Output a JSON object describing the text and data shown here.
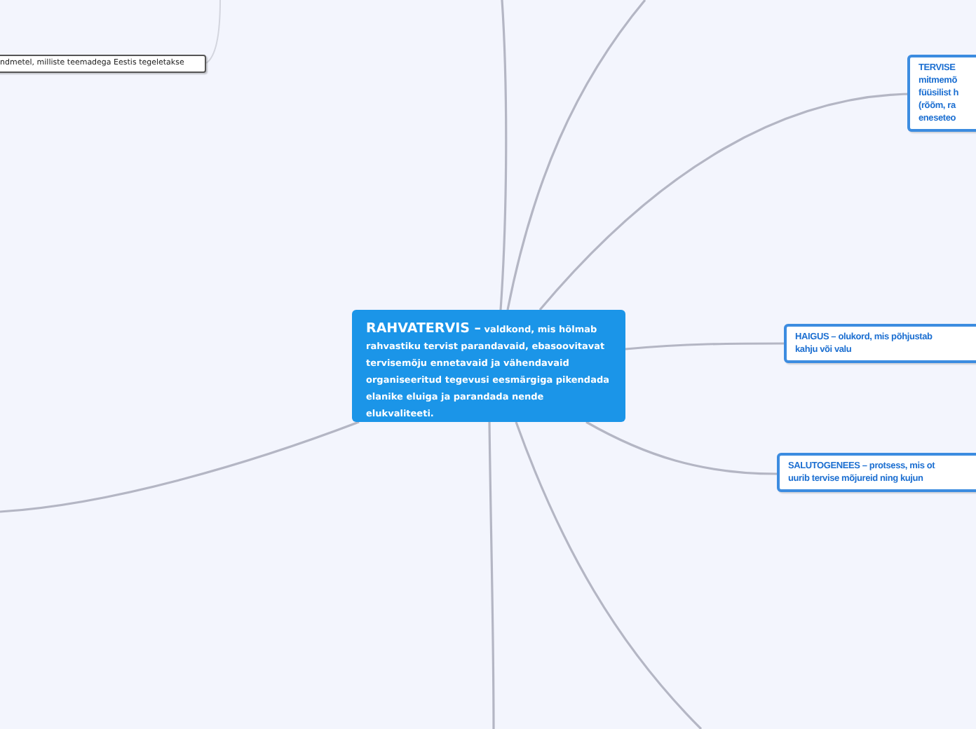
{
  "central_topic": {
    "title": "RAHVATERVIS –",
    "lines": [
      "valdkond, mis hõlmab",
      "rahvastiku tervist parandavaid, ebasoovitavat",
      "tervisemõju ennetavaid ja vähendavaid",
      "organiseeritud tegevusi eesmärgiga pikendada",
      "elanike eluiga ja parandada nende",
      "elukvaliteeti."
    ]
  },
  "topics": [
    {
      "lines": [
        "TERVISE",
        "mitmemõ",
        "füüsilist h",
        "(rõõm, ra",
        "eneseteo"
      ]
    },
    {
      "lines": [
        "HAIGUS – olukord, mis põhjustab",
        "kahju või valu"
      ]
    },
    {
      "lines": [
        "SALUTOGENEES – protsess, mis ot",
        "uurib tervise mõjureid ning kujun"
      ]
    }
  ],
  "side_note": {
    "text": "ndmetel, milliste teemadega Eestis tegeletakse"
  }
}
